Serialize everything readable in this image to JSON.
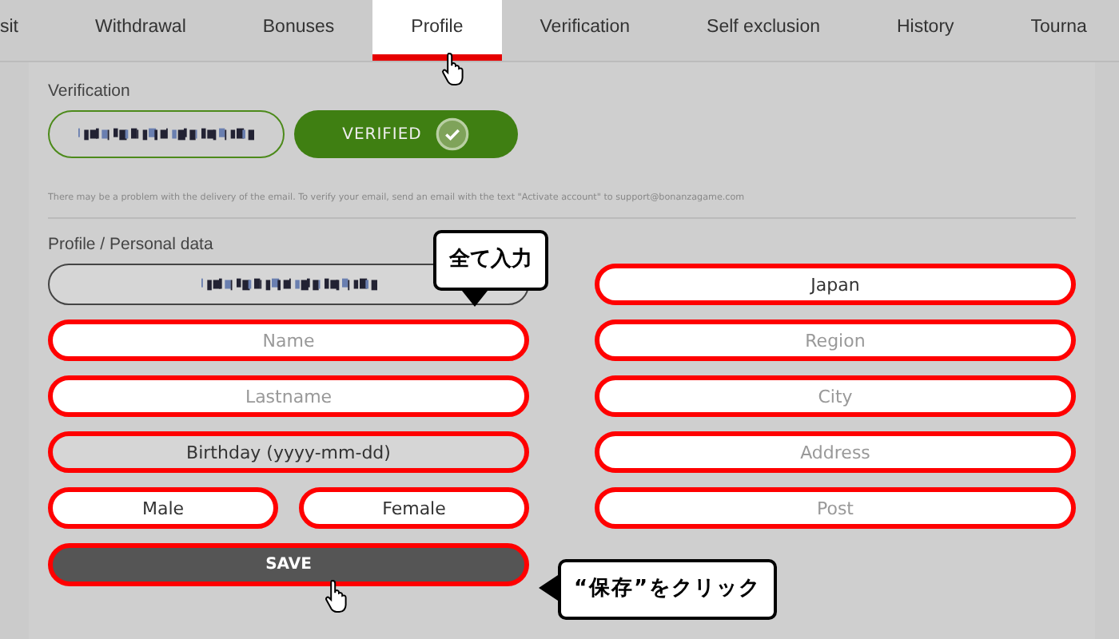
{
  "tabs": [
    {
      "label": "sit",
      "selected": false
    },
    {
      "label": "Withdrawal",
      "selected": false
    },
    {
      "label": "Bonuses",
      "selected": false
    },
    {
      "label": "Profile",
      "selected": true
    },
    {
      "label": "Verification",
      "selected": false
    },
    {
      "label": "Self exclusion",
      "selected": false
    },
    {
      "label": "History",
      "selected": false
    },
    {
      "label": "Tourna",
      "selected": false
    }
  ],
  "verification": {
    "label": "Verification",
    "status": "VERIFIED",
    "verified": true,
    "note": "There may be a problem with the delivery of the email. To verify your email, send an email with the text \"Activate account\" to support@bonanzagame.com"
  },
  "profile": {
    "heading": "Profile / Personal data",
    "left_fields": [
      {
        "kind": "redacted",
        "highlighted": false
      },
      {
        "kind": "text",
        "placeholder": "Name",
        "highlighted": true
      },
      {
        "kind": "text",
        "placeholder": "Lastname",
        "highlighted": true
      },
      {
        "kind": "date",
        "value": "Birthday (yyyy-mm-dd)",
        "highlighted": true
      }
    ],
    "gender_options": [
      {
        "label": "Male",
        "selected": false,
        "highlighted": true
      },
      {
        "label": "Female",
        "selected": false,
        "highlighted": true
      }
    ],
    "right_fields": [
      {
        "kind": "select",
        "value": "Japan",
        "highlighted": true
      },
      {
        "kind": "text",
        "placeholder": "Region",
        "highlighted": true
      },
      {
        "kind": "text",
        "placeholder": "City",
        "highlighted": true
      },
      {
        "kind": "text",
        "placeholder": "Address",
        "highlighted": true
      },
      {
        "kind": "text",
        "placeholder": "Post",
        "highlighted": true
      }
    ],
    "save_button": {
      "label": "SAVE",
      "highlighted": true
    }
  },
  "callouts": [
    {
      "kind": "above",
      "text": "全て入力"
    },
    {
      "kind": "left",
      "text": "“保存”をクリック"
    }
  ]
}
